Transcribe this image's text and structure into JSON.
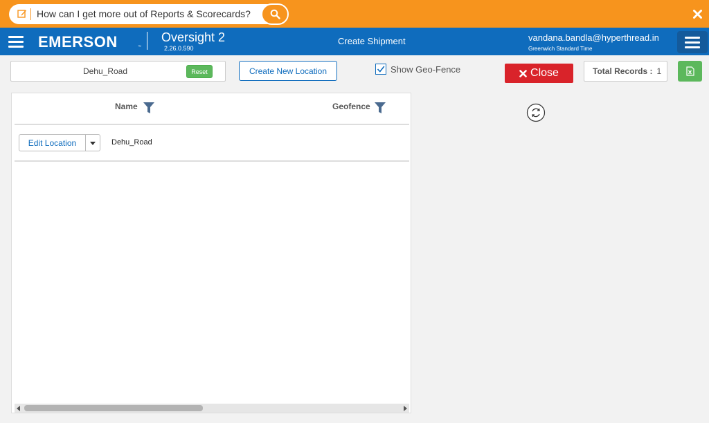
{
  "help_bar": {
    "question": "How can I get more out of Reports & Scorecards?",
    "icons": [
      "edit-icon",
      "search-icon",
      "close-icon"
    ]
  },
  "header": {
    "logo": "EMERSON",
    "logo_tm": "™",
    "app_name": "Oversight 2",
    "version": "2.26.0.590",
    "page_title": "Create Shipment",
    "user_email": "vandana.bandla@hyperthread.in",
    "timezone": "Greenwich Standard Time",
    "brand_color": "#0f6cbd"
  },
  "toolbar": {
    "search_value": "Dehu_Road",
    "reset_label": "Reset",
    "create_label": "Create New Location",
    "geofence_label": "Show Geo-Fence",
    "geofence_checked": true,
    "close_label": "Close",
    "records_label": "Total Records :",
    "records_count": "1"
  },
  "grid": {
    "columns": [
      "Name",
      "Geofence"
    ],
    "rows": [
      {
        "action_label": "Edit Location",
        "name": "Dehu_Road",
        "geofence": ""
      }
    ]
  }
}
